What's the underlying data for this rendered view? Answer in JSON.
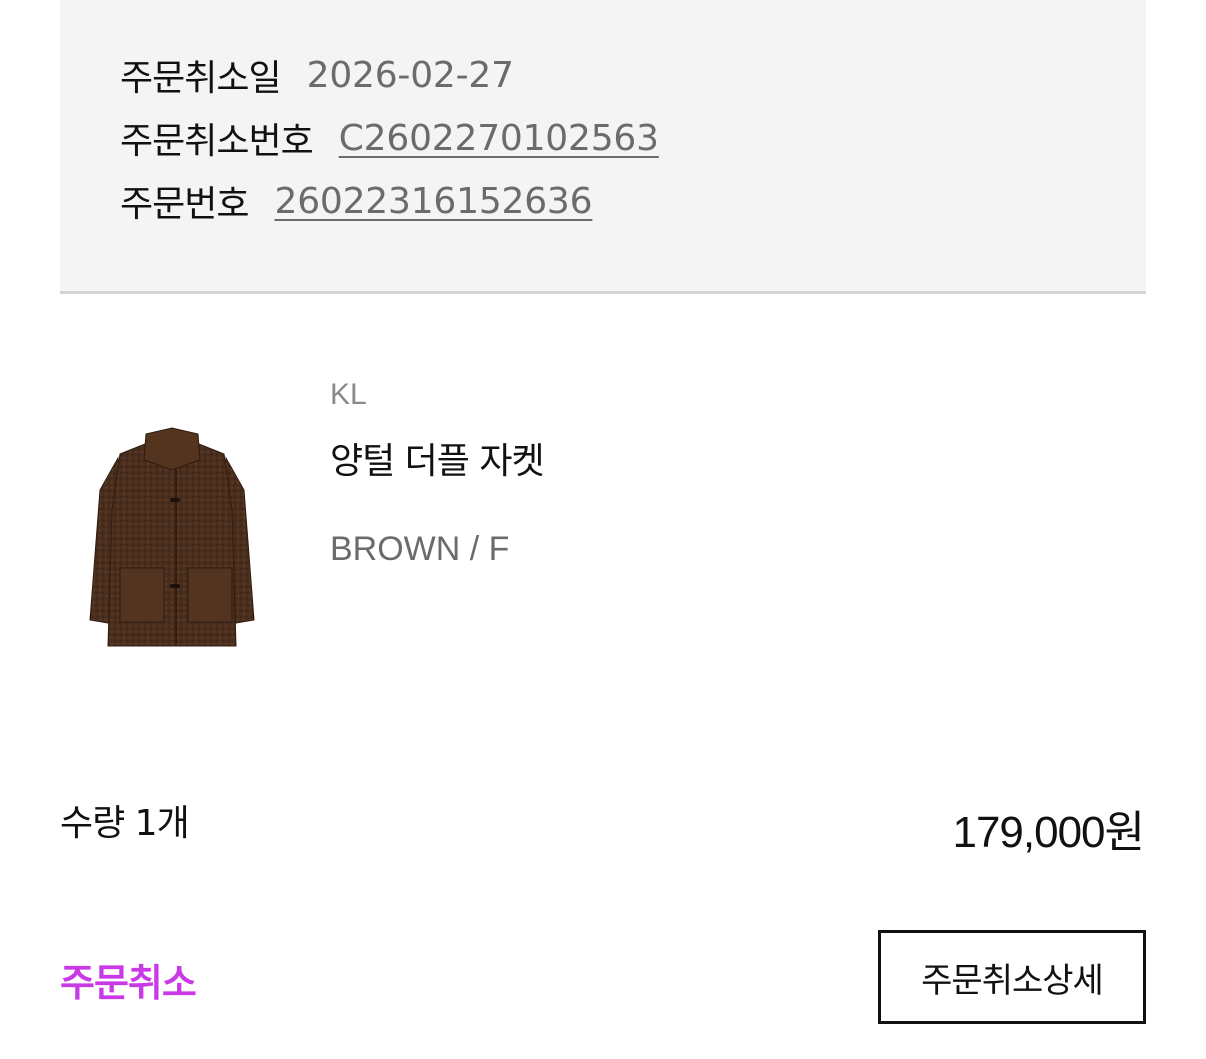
{
  "cancel_info": {
    "cancel_date_label": "주문취소일",
    "cancel_date_value": "2026-02-27",
    "cancel_number_label": "주문취소번호",
    "cancel_number_value": "C2602270102563",
    "order_number_label": "주문번호",
    "order_number_value": "26022316152636"
  },
  "product": {
    "image_icon": "brown-fur-jacket-image",
    "brand": "KL",
    "name": "양털 더플 자켓",
    "option": "BROWN / F"
  },
  "summary": {
    "quantity": "수량 1개",
    "price": "179,000원"
  },
  "footer": {
    "status": "주문취소",
    "detail_button": "주문취소상세"
  },
  "colors": {
    "info_background": "#f4f4f4",
    "status_accent": "#c93ae6",
    "muted_text": "#6b6b6b",
    "product_brown": "#4a2e1d"
  }
}
